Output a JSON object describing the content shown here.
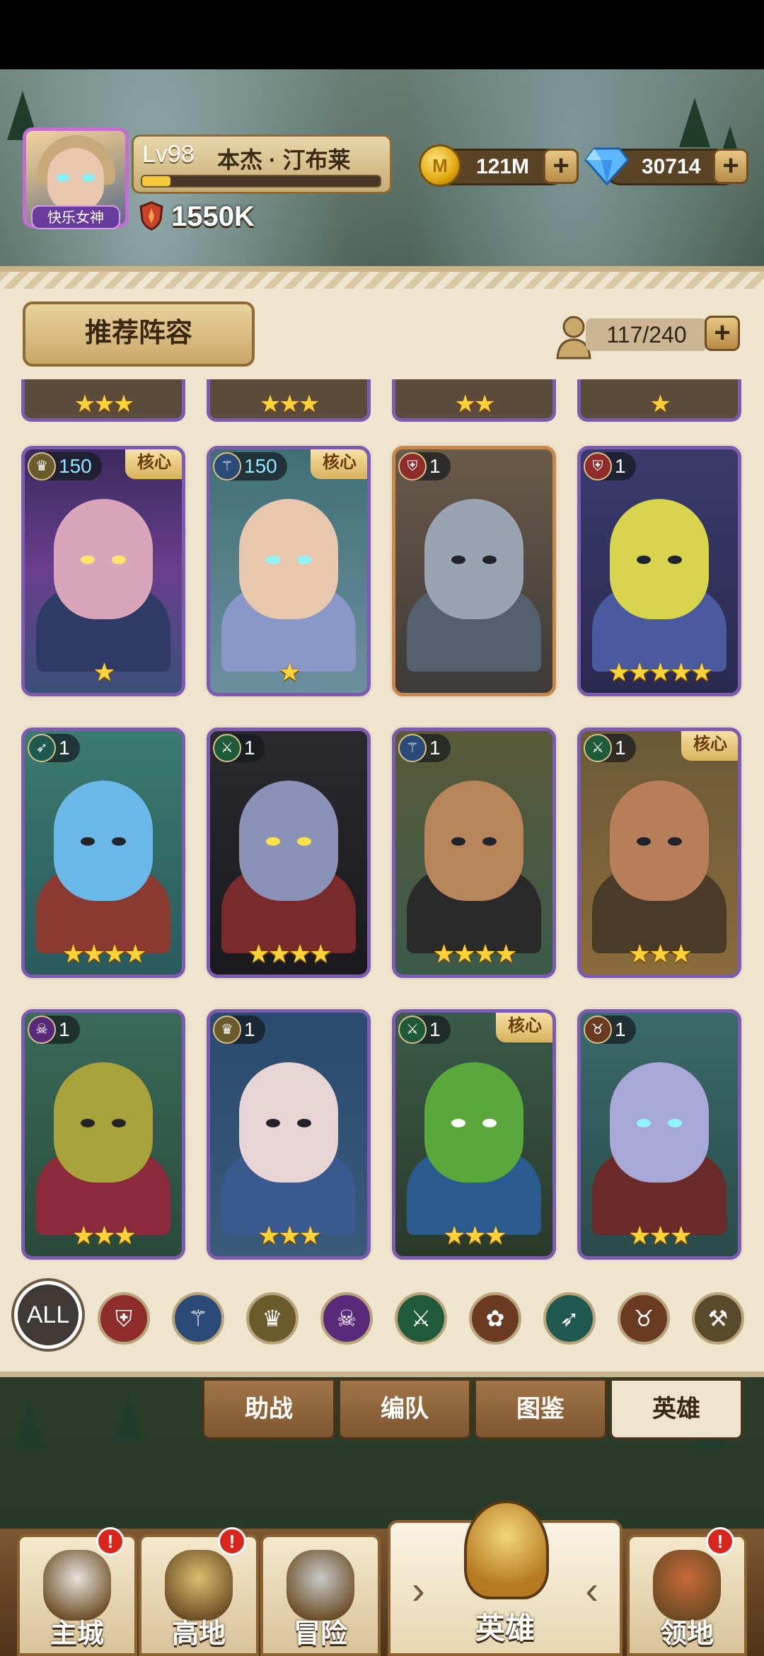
{
  "player": {
    "level": "Lv98",
    "name": "本杰 · 汀布莱",
    "avatar_title": "快乐女神",
    "power": "1550K",
    "exp_fraction": 0.12
  },
  "resources": {
    "coins": "121M",
    "coin_symbol": "M",
    "gems": "30714"
  },
  "panel": {
    "recommend_label": "推荐阵容",
    "hero_count": "117/240"
  },
  "partial_row": [
    {
      "stars": "★★★"
    },
    {
      "stars": "★★★"
    },
    {
      "stars": "★★"
    },
    {
      "stars": "★"
    }
  ],
  "heroes": [
    {
      "level": "150",
      "class_icon": "wing-emblem-icon",
      "core": "核心",
      "stars": "★",
      "theme": "witch"
    },
    {
      "level": "150",
      "class_icon": "staff-icon",
      "core": "核心",
      "stars": "★",
      "theme": "elf"
    },
    {
      "level": "1",
      "class_icon": "shield-icon",
      "core": "",
      "stars": "",
      "theme": "knight"
    },
    {
      "level": "1",
      "class_icon": "shield-icon",
      "core": "",
      "stars": "★★★★★",
      "theme": "horned"
    },
    {
      "level": "1",
      "class_icon": "bow-icon",
      "core": "",
      "stars": "★★★★",
      "theme": "goblin"
    },
    {
      "level": "1",
      "class_icon": "crossed-blades-icon",
      "core": "",
      "stars": "★★★★",
      "theme": "ninja"
    },
    {
      "level": "1",
      "class_icon": "staff-icon",
      "core": "",
      "stars": "★★★★",
      "theme": "mage"
    },
    {
      "level": "1",
      "class_icon": "crossed-blades-icon",
      "core": "核心",
      "stars": "★★★",
      "theme": "bald"
    },
    {
      "level": "1",
      "class_icon": "skull-icon",
      "core": "",
      "stars": "★★★",
      "theme": "orc"
    },
    {
      "level": "1",
      "class_icon": "wing-emblem-icon",
      "core": "",
      "stars": "★★★",
      "theme": "blue-hair"
    },
    {
      "level": "1",
      "class_icon": "crossed-blades-icon",
      "core": "核心",
      "stars": "★★★",
      "theme": "green-orc"
    },
    {
      "level": "1",
      "class_icon": "bull-skull-icon",
      "core": "",
      "stars": "★★★",
      "theme": "demon"
    }
  ],
  "filters": [
    {
      "name": "filter-all",
      "label": "ALL"
    },
    {
      "name": "filter-tank",
      "icon": "shield-icon"
    },
    {
      "name": "filter-mage",
      "icon": "staff-icon"
    },
    {
      "name": "filter-support",
      "icon": "wing-emblem-icon"
    },
    {
      "name": "filter-undead",
      "icon": "skull-icon"
    },
    {
      "name": "filter-warrior",
      "icon": "crossed-blades-icon"
    },
    {
      "name": "filter-beast",
      "icon": "paw-icon"
    },
    {
      "name": "filter-archer",
      "icon": "bow-icon"
    },
    {
      "name": "filter-demon",
      "icon": "bull-skull-icon"
    },
    {
      "name": "filter-hammer",
      "icon": "hammer-icon"
    }
  ],
  "tabs": [
    {
      "label": "助战"
    },
    {
      "label": "编队"
    },
    {
      "label": "图鉴"
    },
    {
      "label": "英雄",
      "active": true
    }
  ],
  "nav": [
    {
      "label": "主城",
      "badge": "!"
    },
    {
      "label": "高地",
      "badge": "!"
    },
    {
      "label": "冒险",
      "badge": ""
    },
    {
      "label": "英雄",
      "badge": "",
      "active": true
    },
    {
      "label": "领地",
      "badge": "!"
    }
  ],
  "colors": {
    "panel_bg": "#efe4cd",
    "card_border": "#7c5bb0",
    "star": "#ffd23a",
    "alert_badge": "#d8261c"
  }
}
